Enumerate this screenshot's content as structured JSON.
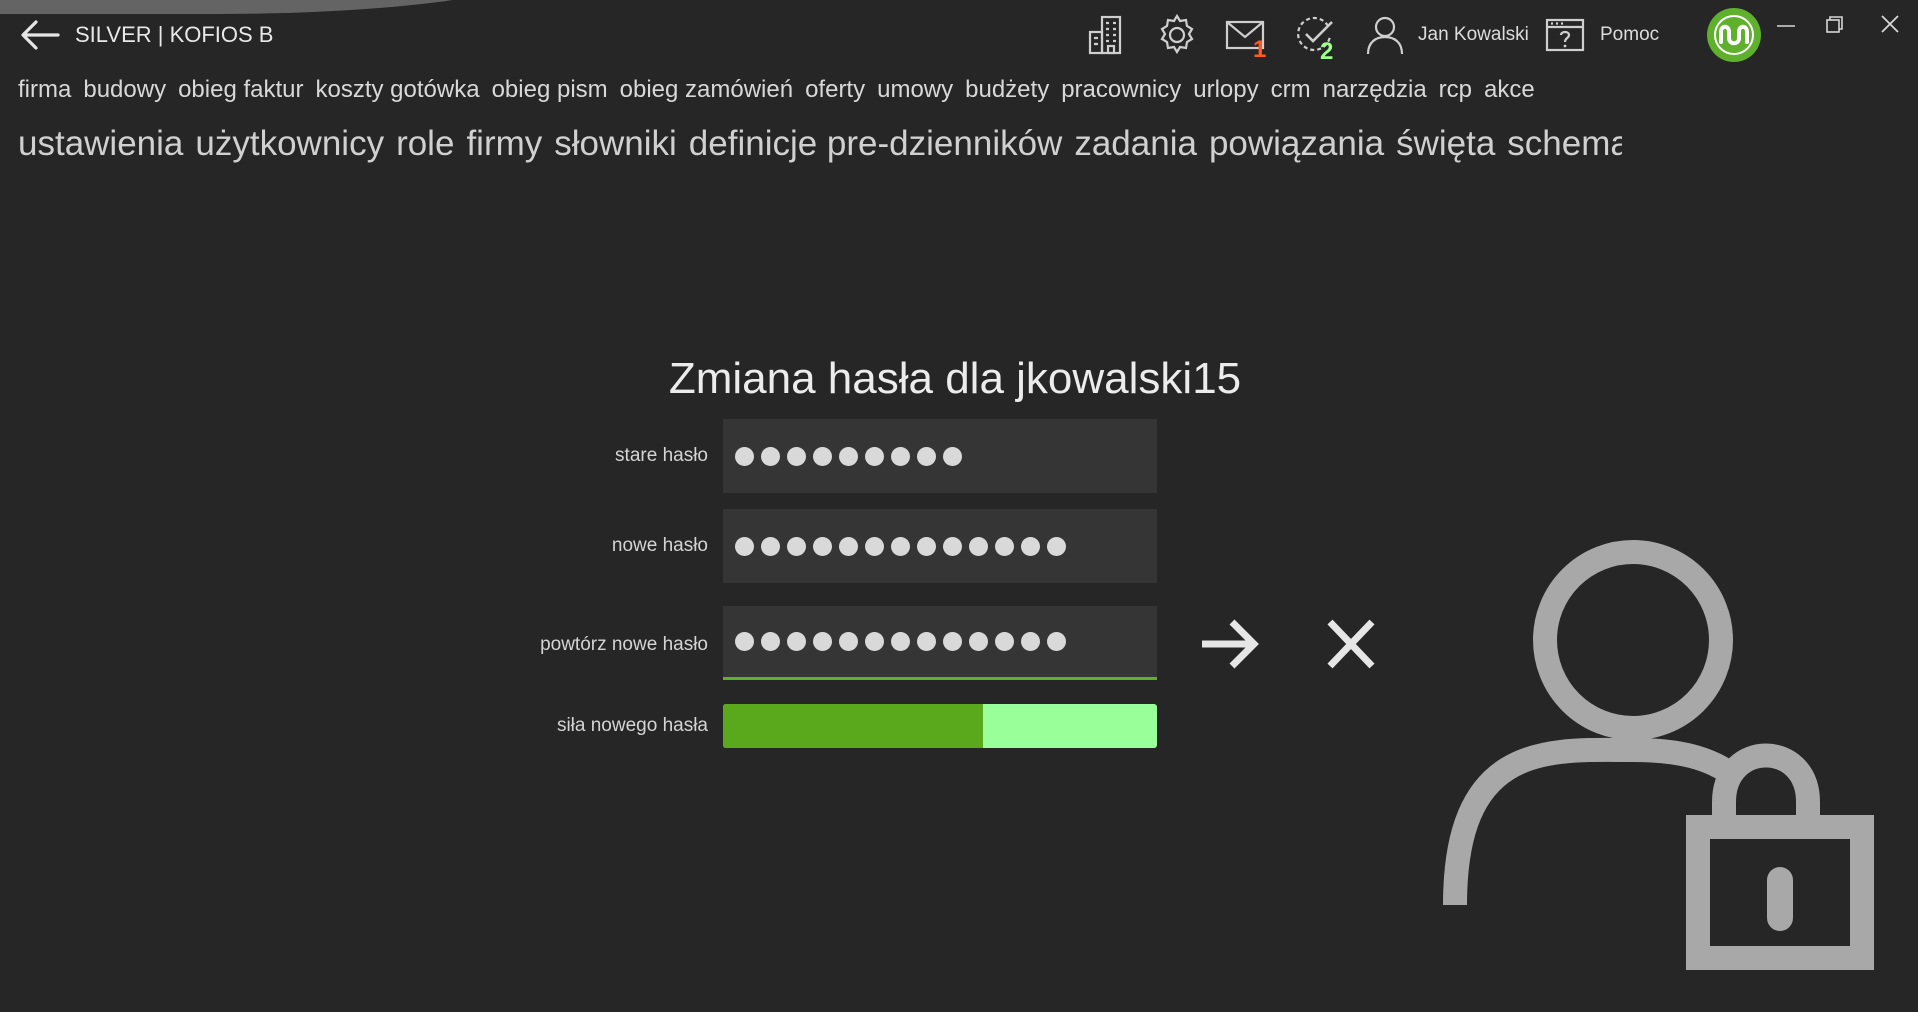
{
  "window": {
    "title": "SILVER | KOFIOS B"
  },
  "toolbar": {
    "icons": [
      "building-icon",
      "gear-icon",
      "mail-icon",
      "tasks-icon",
      "user-icon",
      "help-icon"
    ],
    "mail_badge": "1",
    "tasks_badge": "2",
    "user_name": "Jan Kowalski",
    "help_label": "Pomoc"
  },
  "colors": {
    "background": "#262626",
    "accent_green": "#5fb02c",
    "mail_badge": "#ff5a1f",
    "tasks_badge": "#9cff8a",
    "strength_light": "#99ff99",
    "strength_fill": "#5aa81b"
  },
  "nav": {
    "primary": [
      "firma",
      "budowy",
      "obieg faktur",
      "koszty gotówka",
      "obieg pism",
      "obieg zamówień",
      "oferty",
      "umowy",
      "budżety",
      "pracownicy",
      "urlopy",
      "crm",
      "narzędzia",
      "rcp",
      "akce"
    ],
    "secondary": [
      "ustawienia",
      "użytkownicy",
      "role",
      "firmy",
      "słowniki",
      "definicje pre-dzienników",
      "zadania",
      "powiązania",
      "święta",
      "schematy a"
    ]
  },
  "form": {
    "title": "Zmiana hasła dla jkowalski15",
    "old_password_label": "stare hasło",
    "new_password_label": "nowe hasło",
    "repeat_password_label": "powtórz nowe hasło",
    "strength_label": "siła nowego hasła",
    "old_password_length": 9,
    "new_password_length": 13,
    "repeat_password_length": 13,
    "strength_fraction": 0.6
  }
}
